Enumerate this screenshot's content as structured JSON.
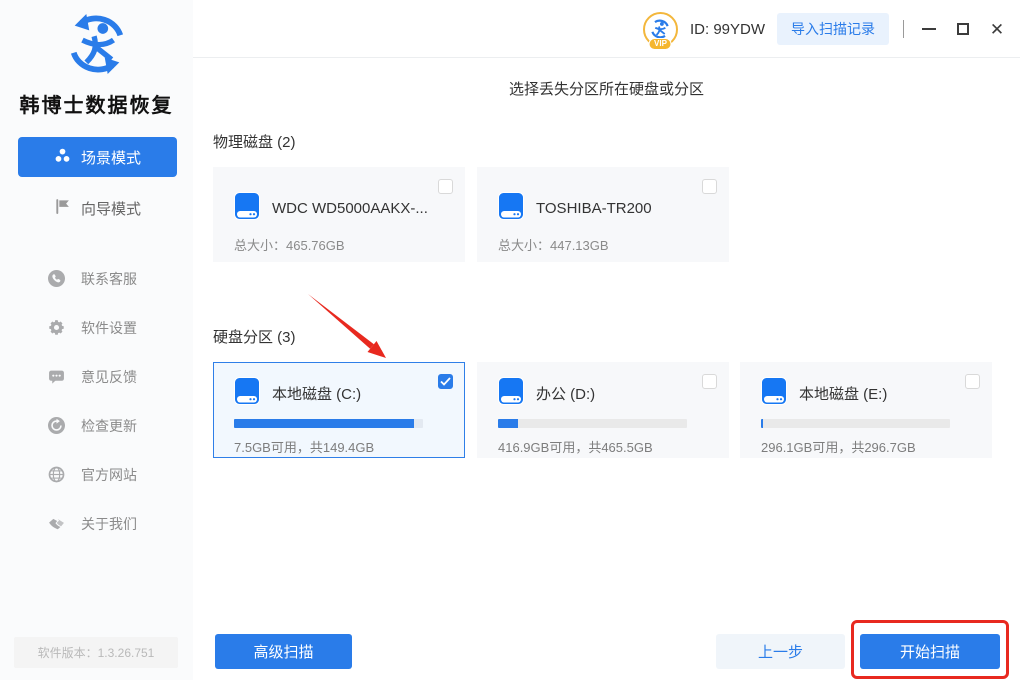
{
  "app": {
    "name": "韩博士数据恢复",
    "version": "软件版本：1.3.26.751"
  },
  "header": {
    "user_id": "ID: 99YDW",
    "import_button": "导入扫描记录",
    "vip_badge": "VIP"
  },
  "sidebar": {
    "modes": [
      {
        "label": "场景模式",
        "active": true
      },
      {
        "label": "向导模式",
        "active": false
      }
    ],
    "items": [
      {
        "label": "联系客服",
        "icon": "phone-icon"
      },
      {
        "label": "软件设置",
        "icon": "gear-icon"
      },
      {
        "label": "意见反馈",
        "icon": "feedback-icon"
      },
      {
        "label": "检查更新",
        "icon": "update-icon"
      },
      {
        "label": "官方网站",
        "icon": "globe-icon"
      },
      {
        "label": "关于我们",
        "icon": "handshake-icon"
      }
    ]
  },
  "main": {
    "title": "选择丢失分区所在硬盘或分区",
    "physical": {
      "label": "物理磁盘 (2)",
      "disks": [
        {
          "name": "WDC WD5000AAKX-...",
          "size": "总大小：465.76GB",
          "checked": false
        },
        {
          "name": "TOSHIBA-TR200",
          "size": "总大小：447.13GB",
          "checked": false
        }
      ]
    },
    "partitions": {
      "label": "硬盘分区 (3)",
      "items": [
        {
          "name": "本地磁盘 (C:)",
          "usage": "7.5GB可用，共149.4GB",
          "used_percent": 95,
          "checked": true,
          "selected": true
        },
        {
          "name": "办公 (D:)",
          "usage": "416.9GB可用，共465.5GB",
          "used_percent": 10.5,
          "checked": false,
          "selected": false
        },
        {
          "name": "本地磁盘 (E:)",
          "usage": "296.1GB可用，共296.7GB",
          "used_percent": 1,
          "checked": false,
          "selected": false
        }
      ]
    }
  },
  "footer": {
    "advanced_scan": "高级扫描",
    "previous_step": "上一步",
    "start_scan": "开始扫描"
  },
  "colors": {
    "primary_blue": "#2a7ce9",
    "disk_icon_blue": "#1677f3",
    "card_bg": "#f7f8fa",
    "selected_card_bg": "#f2f8fe",
    "annotation_red": "#e8291f",
    "sidebar_bg": "#fafbfc"
  }
}
